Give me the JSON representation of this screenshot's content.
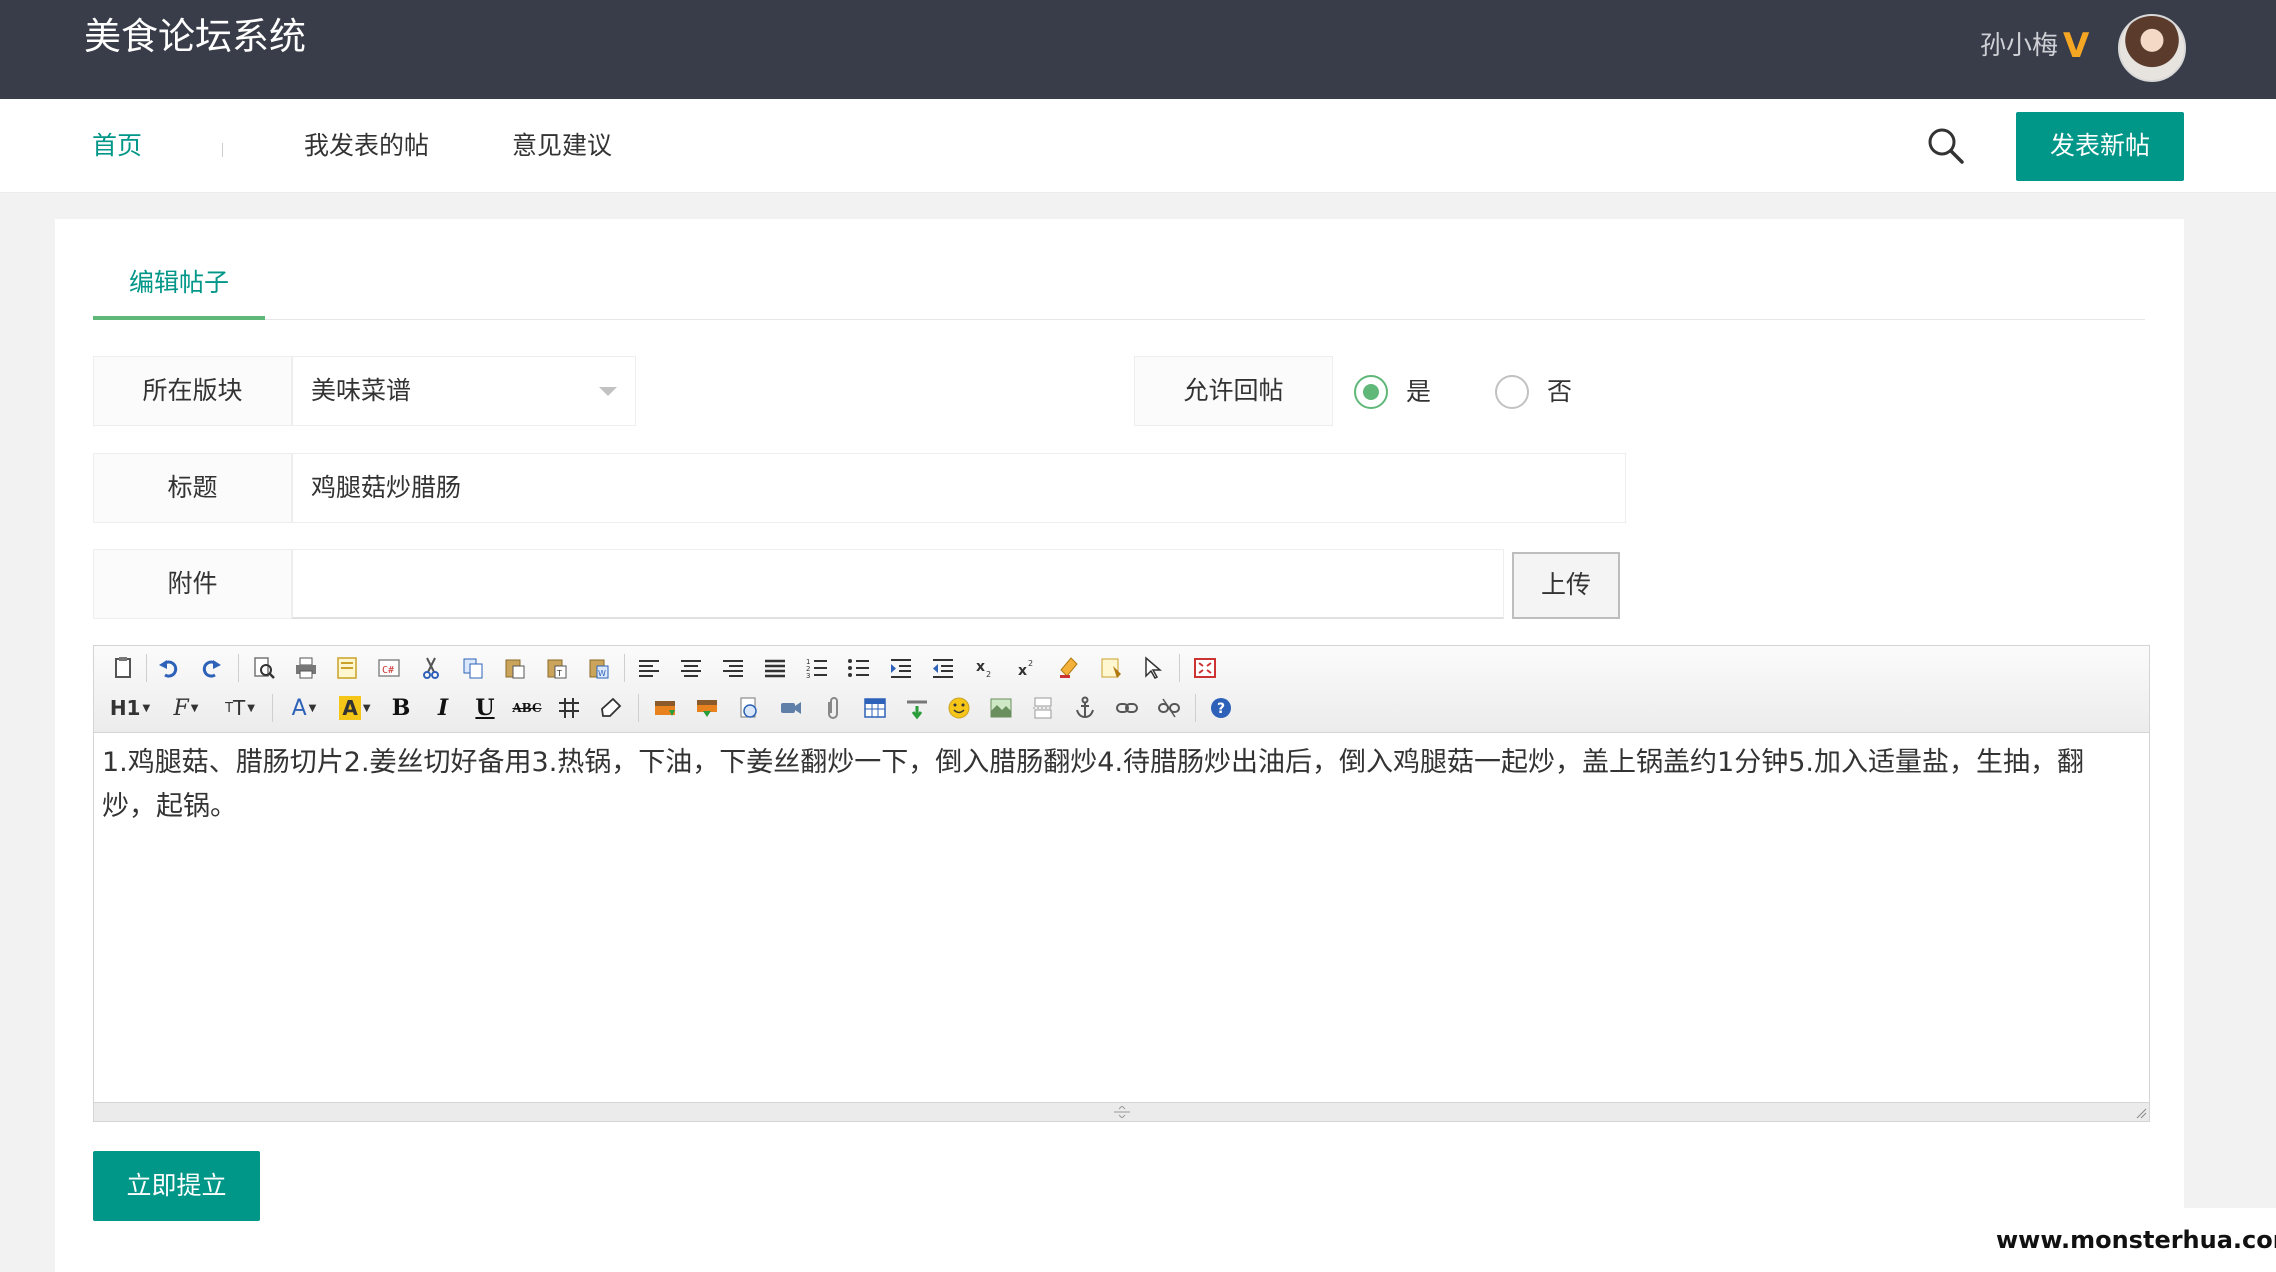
{
  "header": {
    "brand": "美食论坛系统",
    "user_name": "孙小梅",
    "vip_badge": "V",
    "avatar_icon": "user-avatar"
  },
  "nav": {
    "items": [
      {
        "label": "首页",
        "active": true
      },
      {
        "label": "我发表的帖"
      },
      {
        "label": "意见建议"
      }
    ],
    "search_icon": "search-icon",
    "post_button": "发表新帖"
  },
  "form": {
    "tab": "编辑帖子",
    "section_label": "所在版块",
    "section_value": "美味菜谱",
    "allow_reply_label": "允许回帖",
    "radio_yes": "是",
    "radio_no": "否",
    "title_label": "标题",
    "title_value": "鸡腿菇炒腊肠",
    "attach_label": "附件",
    "attach_value": "",
    "upload_button": "上传",
    "content": "1.鸡腿菇、腊肠切片2.姜丝切好备用3.热锅，下油，下姜丝翻炒一下，倒入腊肠翻炒4.待腊肠炒出油后，倒入鸡腿菇一起炒，盖上锅盖约1分钟5.加入适量盐，生抽，翻炒，起锅。",
    "submit_button": "立即提立"
  },
  "toolbar_row1": [
    "source-icon",
    "undo-icon",
    "redo-icon",
    "preview-icon",
    "print-icon",
    "template-icon",
    "code-icon",
    "cut-icon",
    "copy-icon",
    "paste-icon",
    "paste-text-icon",
    "paste-word-icon",
    "align-left-icon",
    "align-center-icon",
    "align-right-icon",
    "justify-icon",
    "ordered-list-icon",
    "unordered-list-icon",
    "indent-icon",
    "outdent-icon",
    "subscript-icon",
    "superscript-icon",
    "clear-format-icon",
    "select-all-icon",
    "cursor-icon",
    "fullscreen-icon"
  ],
  "toolbar_row2": [
    "heading-icon",
    "font-family-icon",
    "font-size-icon",
    "font-color-icon",
    "bg-color-icon",
    "bold-icon",
    "italic-icon",
    "underline-icon",
    "strikethrough-icon",
    "line-height-icon",
    "remove-format-icon",
    "image-icon",
    "multi-image-icon",
    "flash-icon",
    "media-icon",
    "attach-icon",
    "table-icon",
    "hr-icon",
    "emoticon-icon",
    "map-icon",
    "pagebreak-icon",
    "anchor-icon",
    "link-icon",
    "unlink-icon",
    "help-icon"
  ],
  "watermark": "www.monsterhua.com",
  "colors": {
    "accent": "#009688",
    "header_bg": "#393d49",
    "radio_on": "#5fb878"
  }
}
